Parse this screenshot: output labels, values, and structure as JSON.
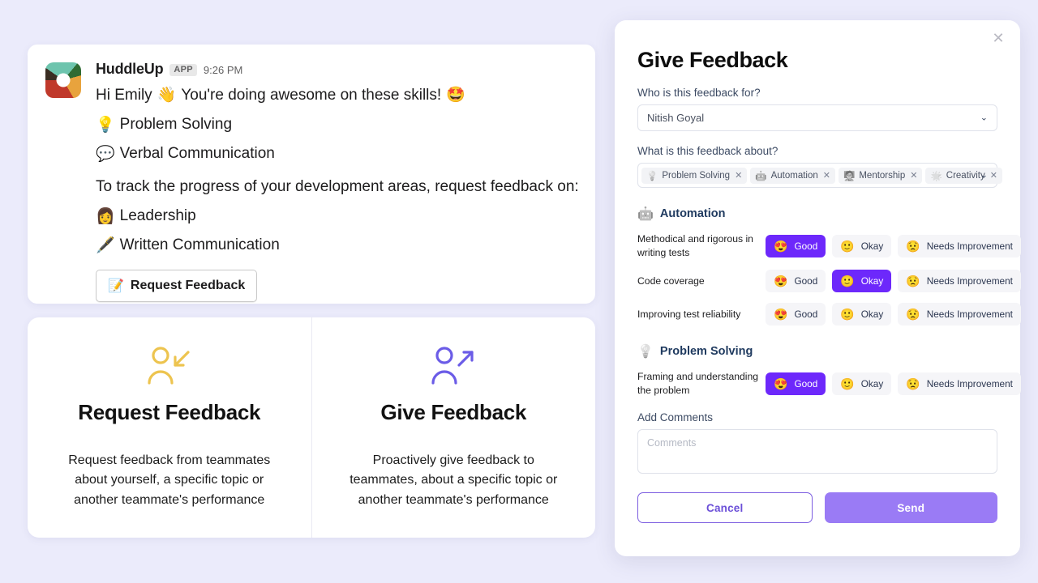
{
  "slack_message": {
    "app_name": "HuddleUp",
    "app_badge": "APP",
    "timestamp": "9:26 PM",
    "greeting_prefix": "Hi Emily",
    "greeting_emoji": "👋",
    "greeting_suffix": "You're doing awesome on these skills!",
    "greeting_end_emoji": "🤩",
    "skills": [
      {
        "emoji": "💡",
        "label": "Problem Solving"
      },
      {
        "emoji": "💬",
        "label": "Verbal Communication"
      }
    ],
    "track_text": "To track the progress of your development areas, request feedback on:",
    "development_areas": [
      {
        "emoji": "👩",
        "label": "Leadership"
      },
      {
        "emoji": "🖋️",
        "label": "Written Communication"
      }
    ],
    "request_button": {
      "emoji": "📝",
      "label": "Request Feedback"
    }
  },
  "option_cards": [
    {
      "icon": "person-arrow-in-icon",
      "icon_color": "#edc44f",
      "title": "Request Feedback",
      "description": "Request feedback from teammates about yourself, a specific topic or another teammate's performance"
    },
    {
      "icon": "person-arrow-out-icon",
      "icon_color": "#6b5ce7",
      "title": "Give Feedback",
      "description": "Proactively give feedback to teammates, about a specific topic or another teammate's performance"
    }
  ],
  "modal": {
    "title": "Give Feedback",
    "close_icon": "✕",
    "recipient": {
      "label": "Who is this feedback for?",
      "value": "Nitish Goyal",
      "caret": "⌄"
    },
    "topics": {
      "label": "What is this feedback about?",
      "caret": "⌄",
      "chips": [
        {
          "emoji": "💡",
          "label": "Problem Solving",
          "remove": "✕"
        },
        {
          "emoji": "🤖",
          "label": "Automation",
          "remove": "✕"
        },
        {
          "emoji": "🧑‍🏫",
          "label": "Mentorship",
          "remove": "✕"
        },
        {
          "emoji": "🌟",
          "label": "Creativity",
          "remove": "✕"
        }
      ]
    },
    "sections": [
      {
        "emoji": "🤖",
        "title": "Automation",
        "questions": [
          {
            "text": "Methodical and rigorous in writing tests",
            "options": [
              {
                "emoji": "😍",
                "label": "Good",
                "selected": true
              },
              {
                "emoji": "🙂",
                "label": "Okay",
                "selected": false
              },
              {
                "emoji": "😟",
                "label": "Needs Improvement",
                "selected": false
              }
            ]
          },
          {
            "text": "Code coverage",
            "options": [
              {
                "emoji": "😍",
                "label": "Good",
                "selected": false
              },
              {
                "emoji": "🙂",
                "label": "Okay",
                "selected": true
              },
              {
                "emoji": "😟",
                "label": "Needs Improvement",
                "selected": false
              }
            ]
          },
          {
            "text": "Improving test reliability",
            "options": [
              {
                "emoji": "😍",
                "label": "Good",
                "selected": false
              },
              {
                "emoji": "🙂",
                "label": "Okay",
                "selected": false
              },
              {
                "emoji": "😟",
                "label": "Needs Improvement",
                "selected": false
              }
            ]
          }
        ]
      },
      {
        "emoji": "💡",
        "title": "Problem Solving",
        "questions": [
          {
            "text": "Framing and understanding the problem",
            "options": [
              {
                "emoji": "😍",
                "label": "Good",
                "selected": true
              },
              {
                "emoji": "🙂",
                "label": "Okay",
                "selected": false
              },
              {
                "emoji": "😟",
                "label": "Needs Improvement",
                "selected": false
              }
            ]
          }
        ]
      }
    ],
    "comments": {
      "label": "Add Comments",
      "placeholder": "Comments",
      "value": ""
    },
    "cancel_label": "Cancel",
    "send_label": "Send"
  },
  "colors": {
    "page_background": "#ebebfb",
    "accent_purple": "#6d28fb",
    "send_purple": "#9a7bf5",
    "cancel_purple": "#6b4fd8",
    "section_title": "#1f3a5f"
  }
}
